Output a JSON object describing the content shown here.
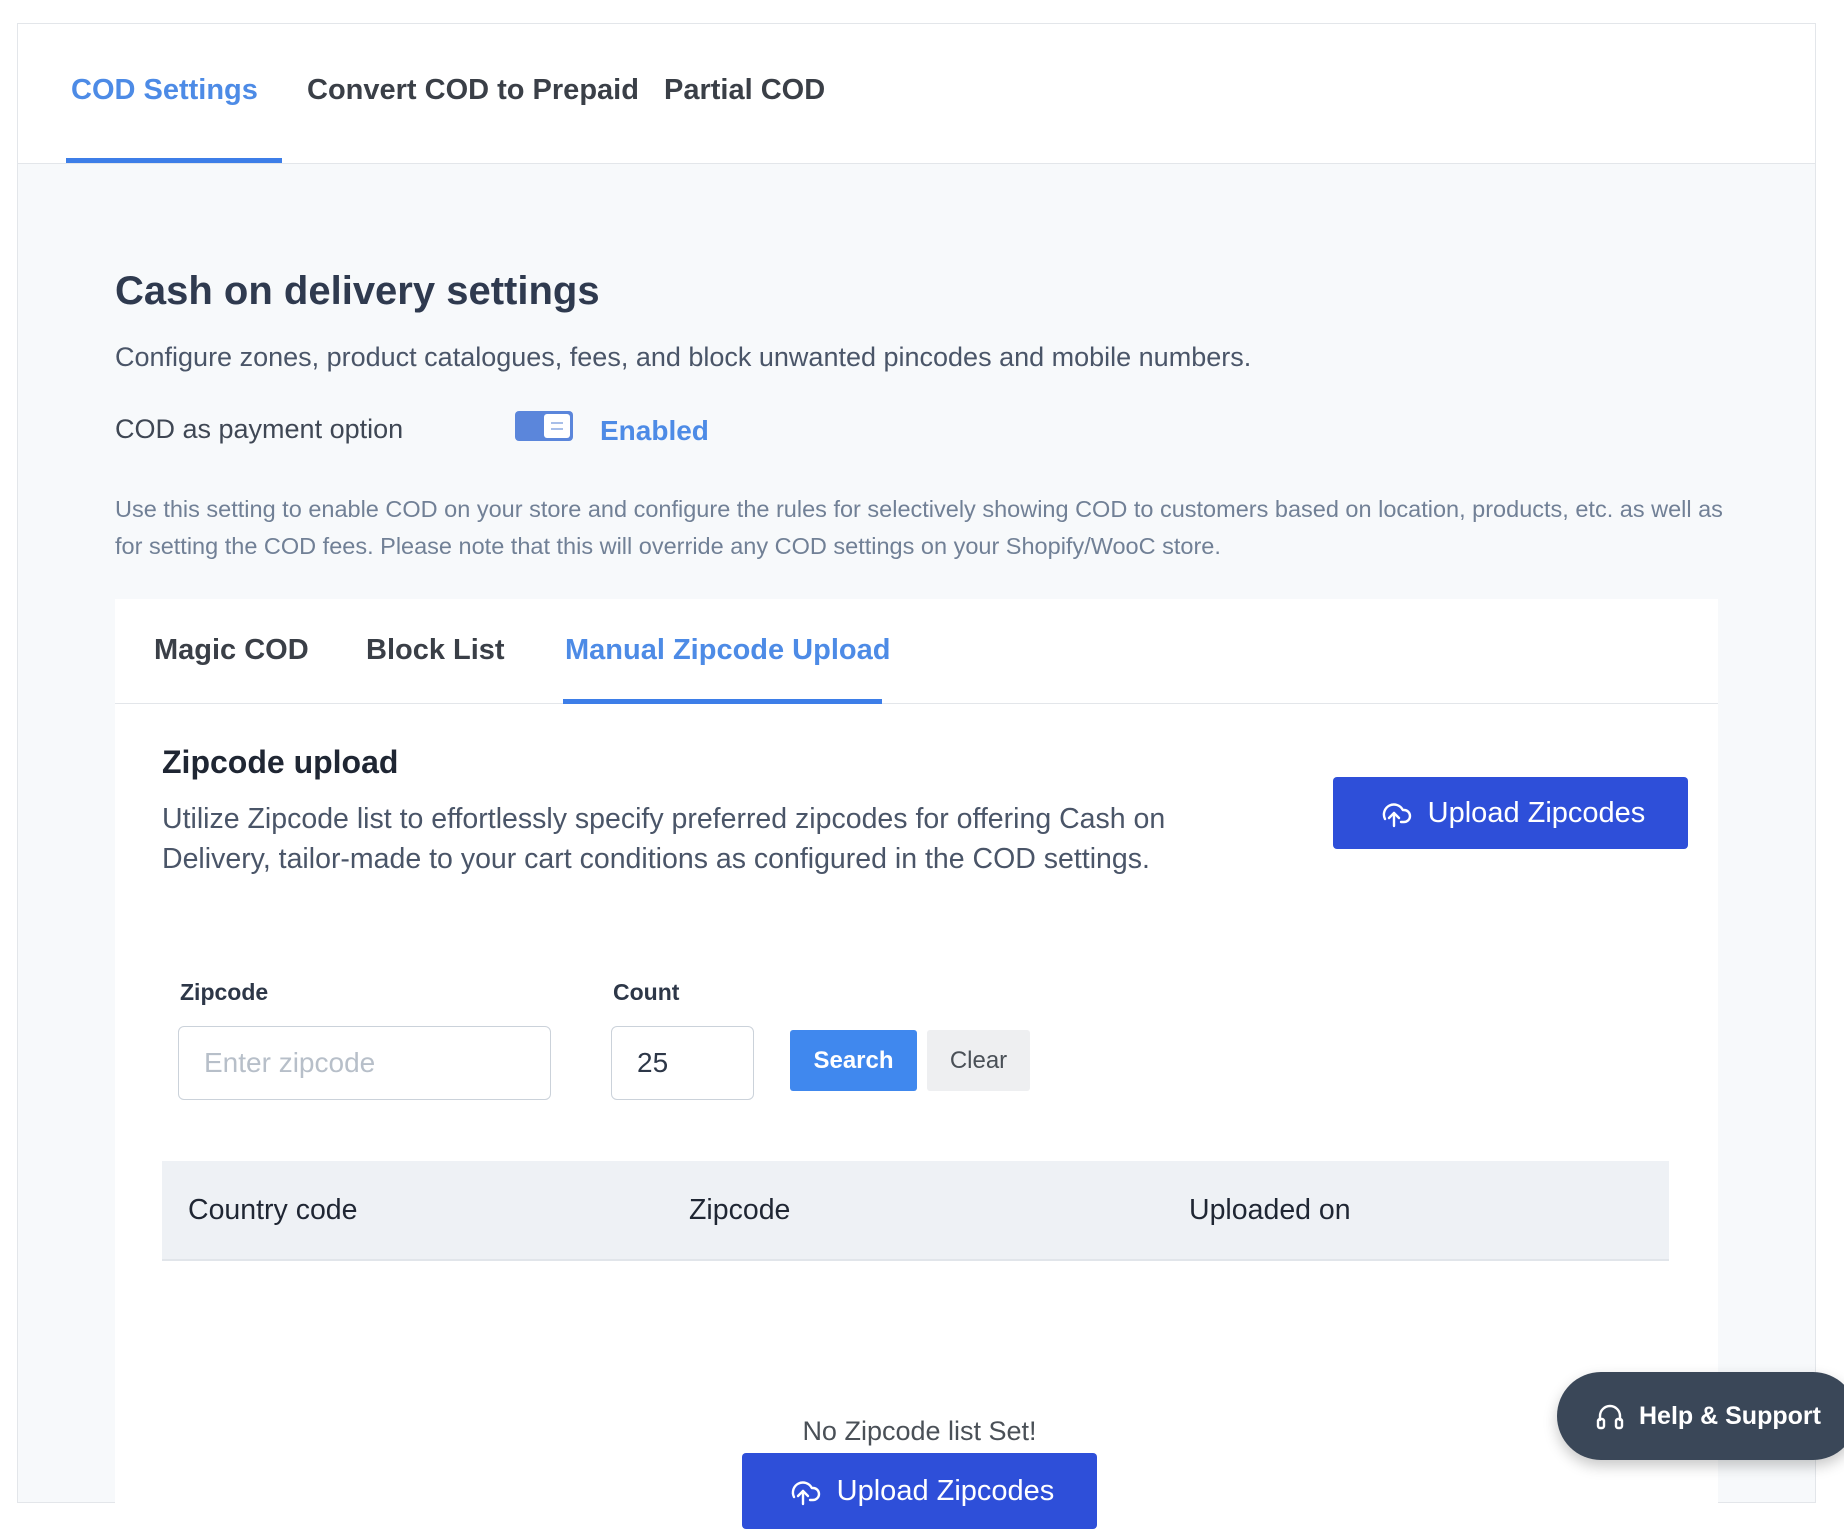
{
  "top_tabs": [
    {
      "label": "COD Settings",
      "active": true
    },
    {
      "label": "Convert COD to Prepaid",
      "active": false
    },
    {
      "label": "Partial COD",
      "active": false
    }
  ],
  "header": {
    "title": "Cash on delivery settings",
    "subtitle": "Configure zones, product catalogues, fees, and block unwanted pincodes and mobile numbers."
  },
  "cod_option": {
    "label": "COD as payment option",
    "toggle_on": true,
    "status": "Enabled"
  },
  "note": "Use this setting to enable COD on your store and configure the rules for selectively showing COD to customers based on location, products, etc. as well as for setting the COD fees. Please note that this will override any COD settings on your Shopify/WooC store.",
  "sub_tabs": [
    {
      "label": "Magic COD",
      "active": false
    },
    {
      "label": "Block List",
      "active": false
    },
    {
      "label": "Manual Zipcode Upload",
      "active": true
    }
  ],
  "zipcode_upload": {
    "title": "Zipcode upload",
    "description": "Utilize Zipcode list to effortlessly specify preferred zipcodes for offering Cash on Delivery, tailor-made to your cart conditions as configured in the COD settings.",
    "upload_button": "Upload Zipcodes",
    "upload_icon": "cloud-upload-icon"
  },
  "filters": {
    "zipcode_label": "Zipcode",
    "zipcode_placeholder": "Enter zipcode",
    "zipcode_value": "",
    "count_label": "Count",
    "count_value": "25",
    "search_button": "Search",
    "clear_button": "Clear"
  },
  "table": {
    "columns": [
      "Country code",
      "Zipcode",
      "Uploaded on"
    ],
    "rows": []
  },
  "empty_state": {
    "message": "No Zipcode list Set!",
    "button": "Upload Zipcodes"
  },
  "help": {
    "label": "Help & Support",
    "icon": "headset-icon"
  },
  "colors": {
    "accent": "#4d8be6",
    "primary_button": "#2e4fd9",
    "search_button": "#4088ee",
    "help_bg": "#3a4758"
  }
}
